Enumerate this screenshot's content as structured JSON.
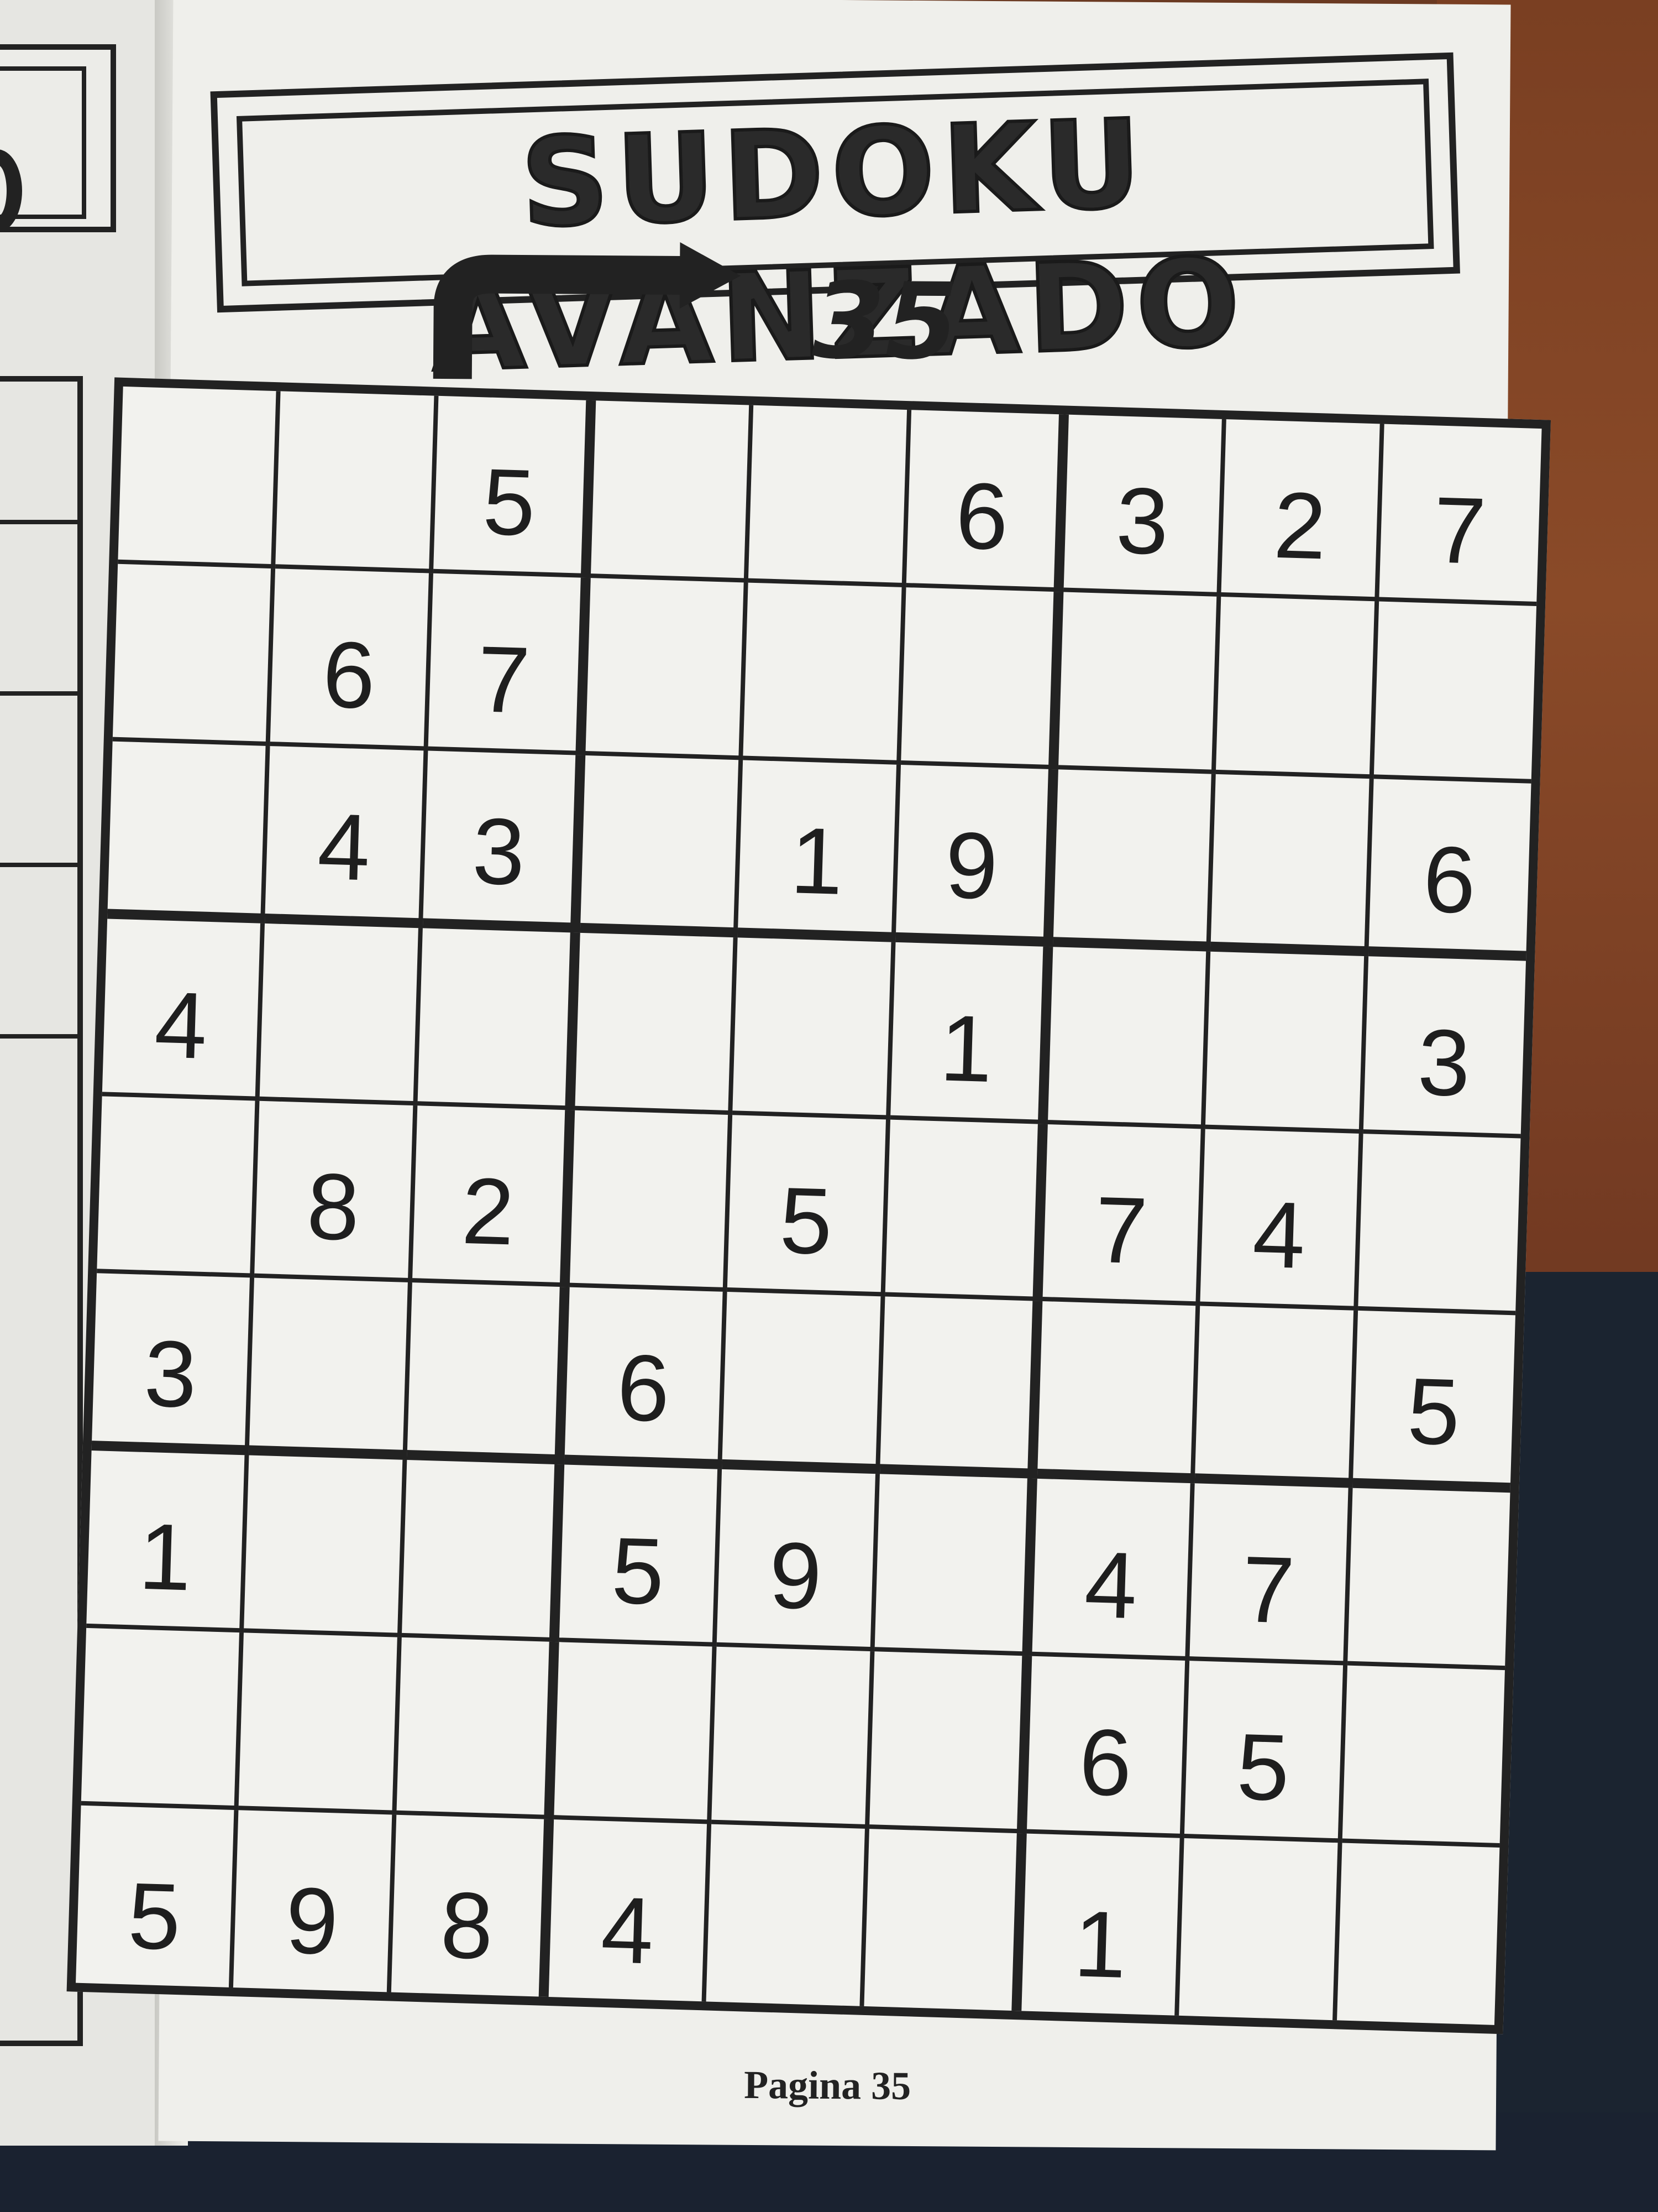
{
  "title": "SUDOKU AVANZADO",
  "puzzle_number": "35",
  "footer": "Pagina 35",
  "grid": [
    [
      "",
      "",
      "5",
      "",
      "",
      "6",
      "3",
      "2",
      "7"
    ],
    [
      "",
      "6",
      "7",
      "",
      "",
      "",
      "",
      "",
      ""
    ],
    [
      "",
      "4",
      "3",
      "",
      "1",
      "9",
      "",
      "",
      "6"
    ],
    [
      "4",
      "",
      "",
      "",
      "",
      "1",
      "",
      "",
      "3"
    ],
    [
      "",
      "8",
      "2",
      "",
      "5",
      "",
      "7",
      "4",
      ""
    ],
    [
      "3",
      "",
      "",
      "6",
      "",
      "",
      "",
      "",
      "5"
    ],
    [
      "1",
      "",
      "",
      "5",
      "9",
      "",
      "4",
      "7",
      ""
    ],
    [
      "",
      "",
      "",
      "",
      "",
      "",
      "6",
      "5",
      ""
    ],
    [
      "5",
      "9",
      "8",
      "4",
      "",
      "",
      "1",
      "",
      ""
    ]
  ],
  "colors": {
    "ink": "#222222",
    "paper": "#efefeb",
    "wood": "#7a3f22"
  },
  "icons": [
    "curved-arrow-icon"
  ]
}
